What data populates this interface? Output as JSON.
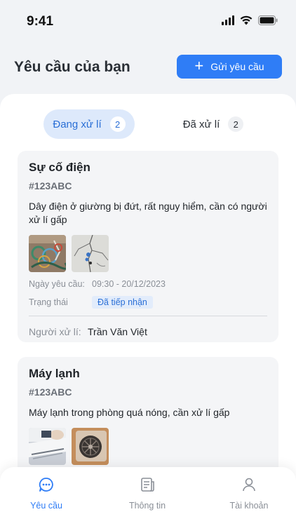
{
  "status_bar": {
    "time": "9:41"
  },
  "header": {
    "title": "Yêu cầu của bạn",
    "send_button_label": "Gửi yêu cầu"
  },
  "tabs": [
    {
      "label": "Đang xử lí",
      "count": "2",
      "active": true
    },
    {
      "label": "Đã xử lí",
      "count": "2",
      "active": false
    }
  ],
  "requests": [
    {
      "title": "Sự cố điện",
      "code": "#123ABC",
      "description": "Dây điện ở giường bị đứt, rất nguy hiểm, cần có người xử lí gấp",
      "date_label": "Ngày yêu cầu:",
      "date_value": "09:30 - 20/12/2023",
      "status_label": "Trạng thái",
      "status_value": "Đã tiếp nhận",
      "handler_label": "Người xử lí:",
      "handler_value": "Trần Văn Việt"
    },
    {
      "title": "Máy lạnh",
      "code": "#123ABC",
      "description": "Máy lạnh trong phòng quá nóng, cần xử lí gấp"
    }
  ],
  "bottom_nav": [
    {
      "label": "Yêu cầu",
      "icon": "chat-bubble-icon",
      "active": true
    },
    {
      "label": "Thông tin",
      "icon": "document-icon",
      "active": false
    },
    {
      "label": "Tài khoản",
      "icon": "user-icon",
      "active": false
    }
  ],
  "colors": {
    "primary": "#2f7df6",
    "tab_active_bg": "#dde9fb",
    "card_bg": "#f4f5f7"
  }
}
